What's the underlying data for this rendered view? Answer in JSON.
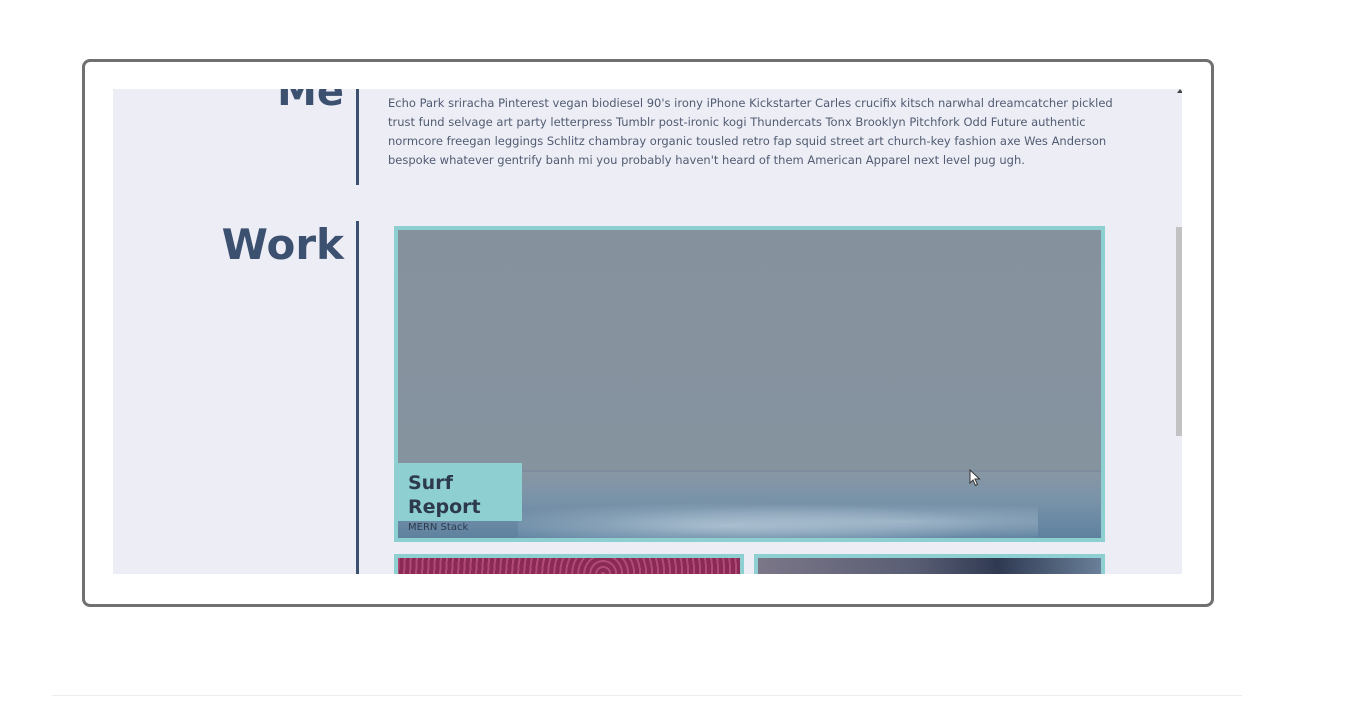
{
  "about": {
    "heading": "Me",
    "text": "Echo Park sriracha Pinterest vegan biodiesel 90's irony iPhone Kickstarter Carles crucifix kitsch narwhal dreamcatcher pickled trust fund selvage art party letterpress Tumblr post-ironic kogi Thundercats Tonx Brooklyn Pitchfork Odd Future authentic normcore freegan leggings Schlitz chambray organic tousled retro fap squid street art church-key fashion axe Wes Anderson bespoke whatever gentrify banh mi you probably haven't heard of them American Apparel next level pug ugh."
  },
  "work": {
    "heading": "Work",
    "projects": [
      {
        "title": "Surf Report",
        "tech": "MERN Stack"
      }
    ]
  },
  "colors": {
    "heading": "#3c5070",
    "accent": "#8ecfd2",
    "page_bg": "#ecedf5",
    "text": "#515c72"
  },
  "icons": {
    "cursor": "mouse-pointer-icon",
    "scroll_up": "scroll-up-arrow-icon"
  }
}
